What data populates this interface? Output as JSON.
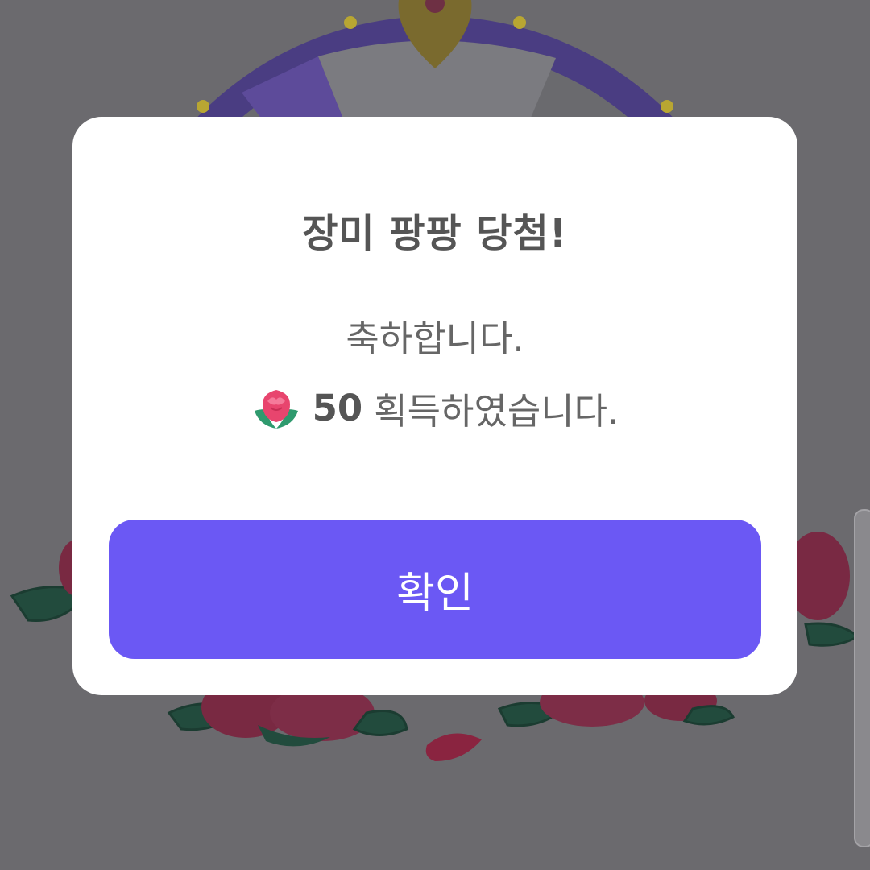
{
  "colors": {
    "overlay": "#6b6a6e",
    "dialog_bg": "#ffffff",
    "button_bg": "#6b58f4",
    "button_text": "#ffffff",
    "title_text": "#555555",
    "body_text": "#666666"
  },
  "dialog": {
    "title": "장미 팡팡 당첨!",
    "line1": "축하합니다.",
    "reward_icon": "rose-icon",
    "reward_amount": "50",
    "reward_suffix": "획득하였습니다.",
    "confirm_label": "확인"
  }
}
